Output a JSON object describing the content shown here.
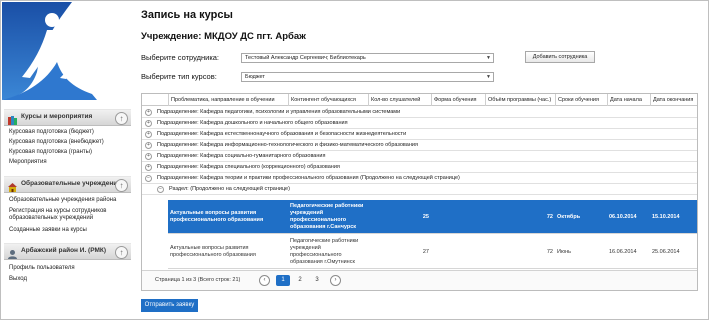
{
  "sidebar": {
    "sections": [
      {
        "title": "Курсы и мероприятия",
        "links": [
          "Курсовая подготовка (бюджет)",
          "Курсовая подготовка (внебюджет)",
          "Курсовая подготовка (гранты)",
          "Мероприятия"
        ]
      },
      {
        "title": "Образовательные учреждения",
        "links": [
          "Образовательные учреждения района",
          "Регистрация на курсы сотрудников",
          "образовательных учреждений",
          "Созданные заявки на курсы"
        ]
      },
      {
        "title": "Арбажский район И. (РМК)",
        "links": [
          "Профиль пользователя",
          "Выход"
        ]
      }
    ]
  },
  "page": {
    "title": "Запись на курсы",
    "institution": "Учреждение: МКДОУ ДС пгт. Арбаж",
    "employee_label": "Выберите сотрудника:",
    "employee_value": "Тестовый Александр Сергеевич; Библиотекарь",
    "add_employee": "Добавить сотрудника",
    "course_type_label": "Выберите тип курсов:",
    "course_type_value": "Бюджет",
    "submit": "Отправить заявку"
  },
  "grid": {
    "columns": [
      "Проблематика, направление в обучении",
      "Контингент обучающихся",
      "Кол-во слушателей",
      "Форма обучения",
      "Объём программы (час.)",
      "Сроки обучения",
      "Дата начала",
      "Дата окончания"
    ],
    "groups": [
      "Подразделение: Кафедра педагогики, психологии и управления образовательными системами",
      "Подразделение: Кафедра дошкольного и начального общего образования",
      "Подразделение: Кафедра естественнонаучного образования и безопасности жизнедеятельности",
      "Подразделение: Кафедра информационно-технологического и физико-математического образования",
      "Подразделение: Кафедра социально-гуманитарного образования",
      "Подразделение: Кафедра специального (коррекционного) образования",
      "Подразделение: Кафедра теории и практики профессионального образования (Продолжено на следующей странице)"
    ],
    "subgroup": "Раздел: (Продолжено на следующей странице)",
    "rows": [
      {
        "topic": "Актуальные вопросы развития профессионального образования",
        "contingent": "Педагогические работники учреждений профессионального образования г.Санчурск",
        "count": "25",
        "form": "",
        "hours": "72",
        "term": "Октябрь",
        "start": "06.10.2014",
        "end": "15.10.2014"
      },
      {
        "topic": "Актуальные вопросы развития профессионального образования",
        "contingent": "Педагогические работники учреждений профессионального образования г.Омутнинск",
        "count": "27",
        "form": "",
        "hours": "72",
        "term": "Июнь",
        "start": "16.06.2014",
        "end": "25.06.2014"
      }
    ],
    "pager": {
      "info": "Страница 1 из 3 (Всего строк: 21)",
      "pages": [
        "1",
        "2",
        "3"
      ],
      "prev": "‹",
      "next": "›"
    }
  }
}
